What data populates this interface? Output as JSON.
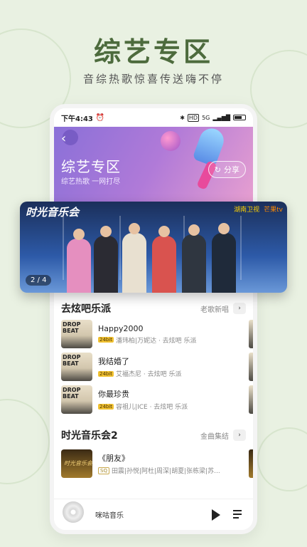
{
  "hero": {
    "title": "综艺专区",
    "subtitle": "音综热歌惊喜传送嗨不停"
  },
  "statusbar": {
    "time": "下午4:43",
    "icons": [
      "alarm-icon",
      "bluetooth-icon",
      "hd-icon",
      "signal-icon",
      "battery-icon"
    ],
    "network": "5G"
  },
  "banner": {
    "back": "‹",
    "title": "综艺专区",
    "subtitle": "综艺热歌 一网打尽",
    "share_label": "分享"
  },
  "carousel": {
    "show_logo": "时光音乐会",
    "channel1": "湖南卫视",
    "channel2": "芒果tv",
    "page_indicator": "2 / 4"
  },
  "sections": [
    {
      "title": "去炫吧乐派",
      "more_label": "老歌新唱",
      "songs": [
        {
          "name": "Happy2000",
          "tag": "24bit",
          "meta": "潘玮柏|万妮达 · 去炫吧 乐派"
        },
        {
          "name": "我结婚了",
          "tag": "24bit",
          "meta": "艾福杰尼 · 去炫吧 乐派"
        },
        {
          "name": "你最珍贵",
          "tag": "24bit",
          "meta": "容祖儿|ICE · 去炫吧 乐派"
        }
      ]
    },
    {
      "title": "时光音乐会2",
      "more_label": "金曲集结",
      "songs": [
        {
          "name": "《朋友》",
          "tag": "SQ",
          "meta": "田震|孙悦|阿杜|周深|胡夏|张栋梁|苏..."
        }
      ]
    }
  ],
  "player": {
    "name": "咪咕音乐"
  },
  "colors": {
    "background": "#e9f1e2",
    "hero_title": "#4d6b3d",
    "banner_gradient_start": "#8a70d8",
    "banner_gradient_end": "#e79fd0"
  }
}
